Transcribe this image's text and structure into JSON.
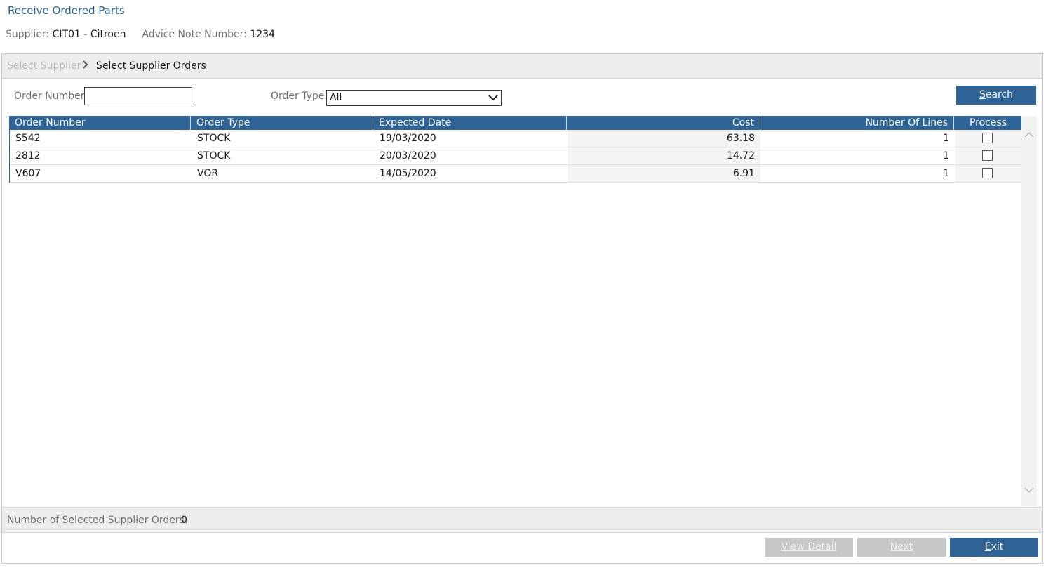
{
  "page": {
    "title": "Receive Ordered Parts",
    "supplier_label": "Supplier:",
    "supplier_value": "CIT01 - Citroen",
    "advice_label": "Advice Note Number:",
    "advice_value": "1234"
  },
  "breadcrumb": {
    "step1": "Select Supplier",
    "step2": "Select Supplier Orders"
  },
  "filters": {
    "order_number_label": "Order Number",
    "order_number_value": "",
    "order_type_label": "Order Type",
    "order_type_value": "All",
    "search_prefix": "S",
    "search_rest": "earch"
  },
  "grid": {
    "columns": [
      "Order Number",
      "Order Type",
      "Expected Date",
      "Cost",
      "Number Of Lines",
      "Process"
    ],
    "rows": [
      {
        "order_number": "S542",
        "order_type": "STOCK",
        "expected_date": "19/03/2020",
        "cost": "63.18",
        "lines": "1",
        "process": false
      },
      {
        "order_number": "2812",
        "order_type": "STOCK",
        "expected_date": "20/03/2020",
        "cost": "14.72",
        "lines": "1",
        "process": false
      },
      {
        "order_number": "V607",
        "order_type": "VOR",
        "expected_date": "14/05/2020",
        "cost": "6.91",
        "lines": "1",
        "process": false
      }
    ]
  },
  "footer": {
    "selected_label": "Number of Selected Supplier Orders:",
    "selected_value": "0",
    "view_detail_prefix": "V",
    "view_detail_rest": "iew Detail",
    "next_prefix": "N",
    "next_rest": "ext",
    "exit_prefix": "E",
    "exit_rest": "xit"
  },
  "colors": {
    "accent": "#2f6396",
    "title": "#2d5f8e",
    "disabled": "#c7c7c7"
  }
}
